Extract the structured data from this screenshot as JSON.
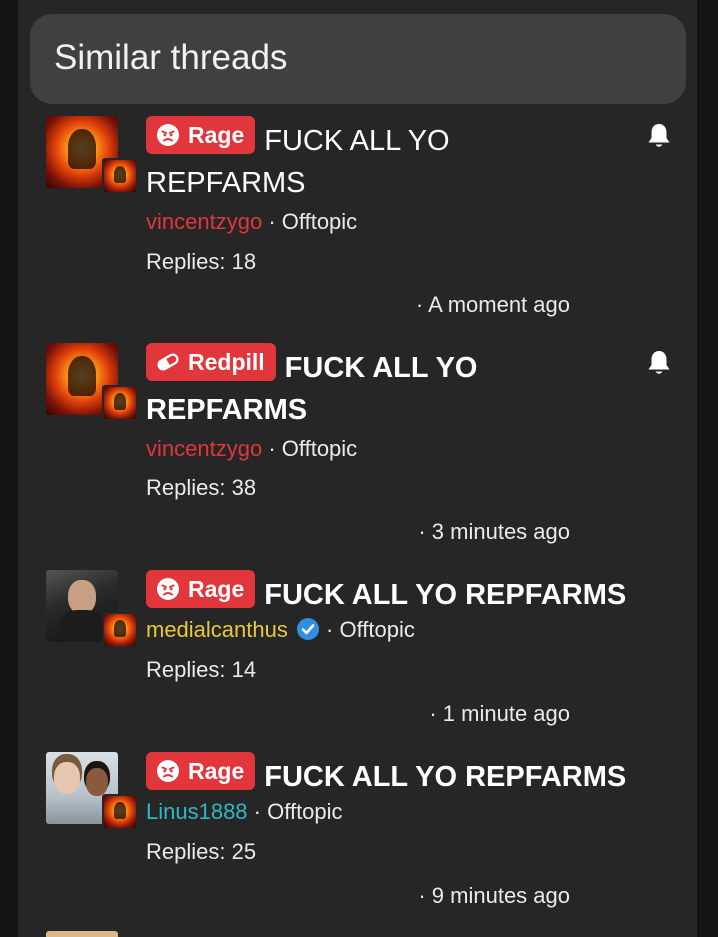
{
  "header": {
    "title": "Similar threads"
  },
  "threads": [
    {
      "prefix": "Rage",
      "prefix_icon": "angry-face-icon",
      "title_line1": "FUCK ALL YO",
      "title_line2": "REPFARMS",
      "author": "vincentzygo",
      "separator": "·",
      "forum": "Offtopic",
      "replies": "Replies: 18",
      "time": "· A moment ago",
      "watched": true
    },
    {
      "prefix": "Redpill",
      "prefix_icon": "pill-icon",
      "title_line1": "FUCK ALL YO",
      "title_line2": "REPFARMS",
      "author": "vincentzygo",
      "separator": "·",
      "forum": "Offtopic",
      "replies": "Replies: 38",
      "time": "· 3 minutes ago",
      "watched": true
    },
    {
      "prefix": "Rage",
      "prefix_icon": "angry-face-icon",
      "title_line1": "FUCK ALL YO REPFARMS",
      "author": "medialcanthus",
      "verified": true,
      "separator": "·",
      "forum": "Offtopic",
      "replies": "Replies: 14",
      "time": "· 1 minute ago"
    },
    {
      "prefix": "Rage",
      "prefix_icon": "angry-face-icon",
      "title_line1": "FUCK ALL YO REPFARMS",
      "author": "Linus1888",
      "separator": "·",
      "forum": "Offtopic",
      "replies": "Replies: 25",
      "time": "· 9 minutes ago"
    }
  ],
  "colors": {
    "prefix_bg": "#e0363c",
    "user_red": "#e0363c",
    "user_yellow": "#e8c93a",
    "user_teal": "#2fb8c4",
    "verified_blue": "#2f8fe0"
  }
}
